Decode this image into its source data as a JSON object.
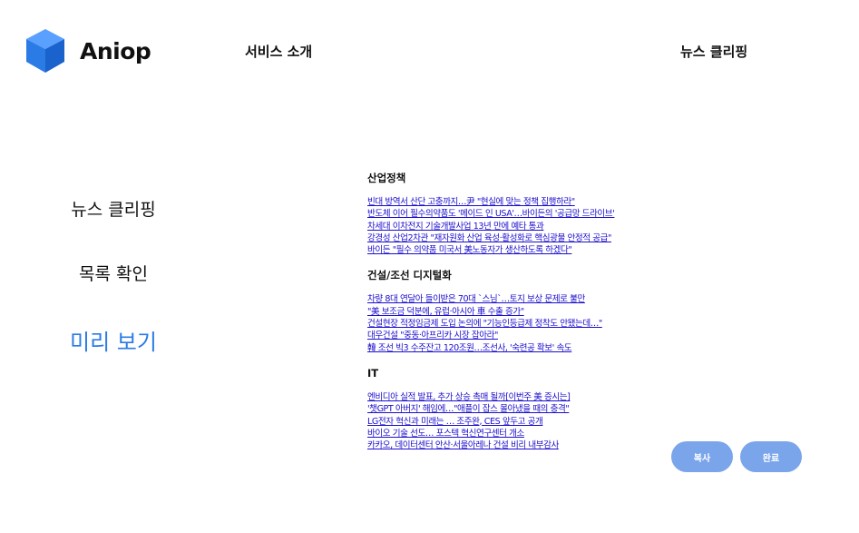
{
  "header": {
    "brand": "Aniop",
    "nav_intro": "서비스 소개",
    "nav_clipping": "뉴스 클리핑"
  },
  "sidebar": {
    "items": [
      {
        "label": "뉴스 클리핑"
      },
      {
        "label": "목록 확인"
      },
      {
        "label": "미리 보기",
        "active": true
      }
    ]
  },
  "sections": [
    {
      "title": "산업정책",
      "articles": [
        "빈대 방역서 산단 고충까지…尹 \"현실에 맞는 정책 집행하라\"",
        "반도체 이어 필수의약품도 '메이드 인 USA'…바이든의 '공급망 드라이브'",
        "차세대 이차전지 기술개발사업 13년 만에 예타 통과",
        "강경성 산업2차관 \"재자원화 산업 육성·활성화로 핵심광물 안정적 공급\"",
        "바이든 \"필수 의약품 미국서 美노동자가 생산하도록 하겠다\""
      ]
    },
    {
      "title": "건설/조선 디지털화",
      "articles": [
        "차량 8대 연달아 들이받은 70대 `스님`…토지 보상 문제로 불만",
        "\"美 보조금 덕분에, 유럽·아시아 車 수출 증가\"",
        "건설현장 적정임금제 도입 논의에 \"기능인등급제 정착도 안됐는데…\"",
        "대우건설 \"중동·아프리카 시장 잡아라\"",
        "韓 조선 빅3 수주잔고 120조원…조선사, '숙련공 확보' 속도"
      ]
    },
    {
      "title": "IT",
      "articles": [
        "엔비디아 실적 발표, 추가 상승 촉매 될까[이번주 美 증시는]",
        "'챗GPT 아버지' 해임에…\"애플이 잡스 몰아냈을 때의 충격\"",
        "LG전자 혁신과 미래는 … 조주완, CES 앞두고 공개",
        "바이오 기술 선도… 포스텍 혁신연구센터 개소",
        "카카오, 데이터센터 안산·서울아레나 건설 비리 내부감사"
      ]
    }
  ],
  "buttons": {
    "copy": "복사",
    "done": "완료"
  },
  "colors": {
    "brand_blue": "#2b7be6",
    "button_blue": "#7aa5ea",
    "link": "#1a0dcc"
  },
  "icons": {
    "logo": "cube-icon"
  }
}
